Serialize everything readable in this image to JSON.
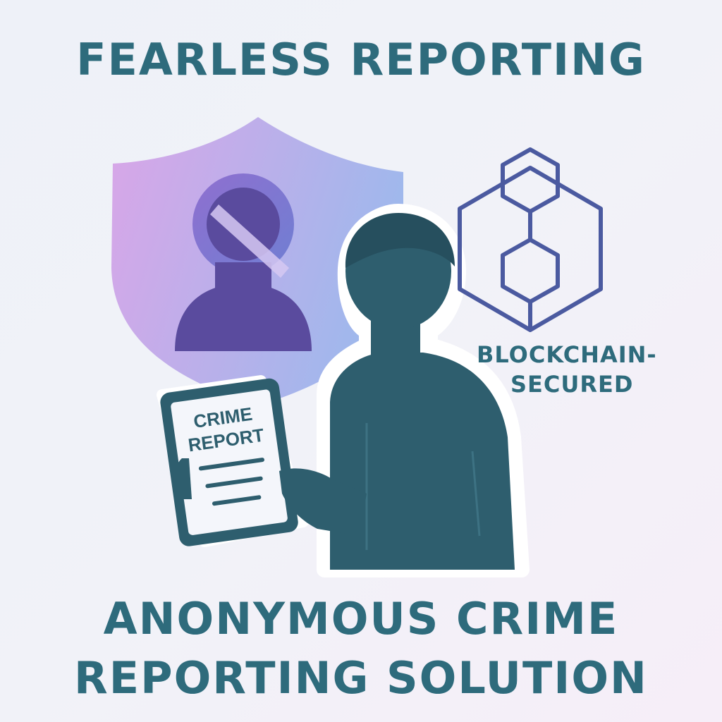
{
  "header": {
    "title": "FEARLESS REPORTING"
  },
  "blockchain": {
    "label_line1": "BLOCKCHAIN-",
    "label_line2": "SECURED",
    "icon": "hexagon-chain-icon"
  },
  "tablet": {
    "title_line1": "CRIME",
    "title_line2": "REPORT"
  },
  "footer": {
    "line1": "ANONYMOUS CRIME",
    "line2": "REPORTING SOLUTION"
  },
  "icons": {
    "shield": "shield-icon",
    "anonymous_person": "anonymous-person-icon",
    "person": "person-icon"
  },
  "colors": {
    "text": "#2e6b7c",
    "person": "#2e5e6e",
    "shield_start": "#d9a6e8",
    "shield_end": "#9db6ea",
    "hexagon_stroke": "#4b5aa0"
  }
}
